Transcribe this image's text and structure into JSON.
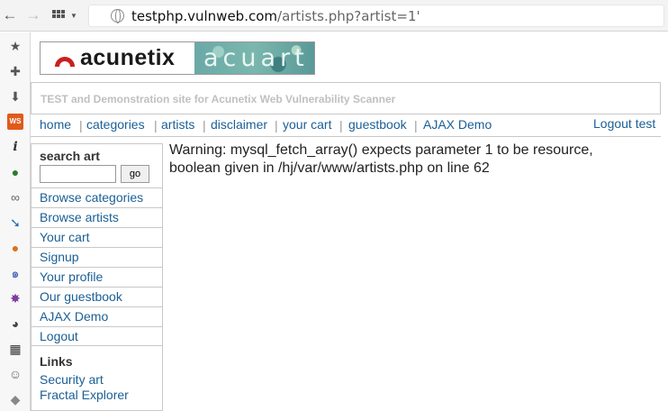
{
  "browser": {
    "url_host": "testphp.vulnweb.com",
    "url_path": "/artists.php?artist=1'"
  },
  "logo": {
    "brand": "acunetix",
    "product": "acuart"
  },
  "tagline": "TEST and Demonstration site for Acunetix Web Vulnerability Scanner",
  "topnav": {
    "items": [
      "home",
      "categories",
      "artists",
      "disclaimer",
      "your cart",
      "guestbook",
      "AJAX Demo"
    ],
    "logout": "Logout test"
  },
  "sidebar": {
    "search_title": "search art",
    "search_value": "",
    "go_label": "go",
    "items": [
      "Browse categories",
      "Browse artists",
      "Your cart",
      "Signup",
      "Your profile",
      "Our guestbook",
      "AJAX Demo",
      "Logout"
    ],
    "links_title": "Links",
    "links": [
      "Security art",
      "Fractal Explorer"
    ]
  },
  "main": {
    "warning": "Warning: mysql_fetch_array() expects parameter 1 to be resource, boolean given in /hj/var/www/artists.php on line 62"
  }
}
